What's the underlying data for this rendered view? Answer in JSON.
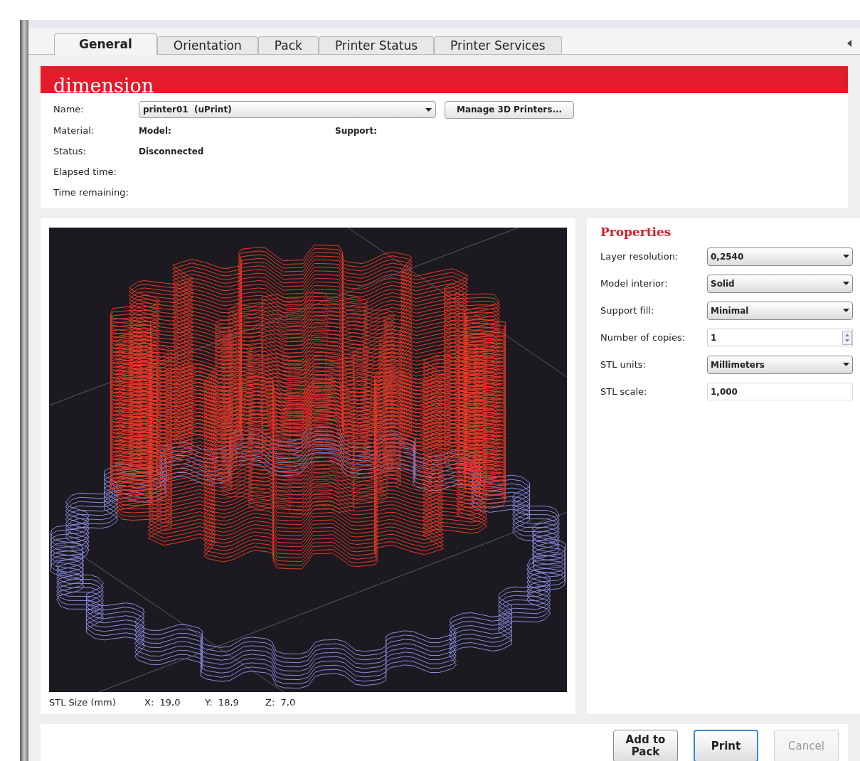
{
  "tabs": [
    {
      "label": "General",
      "selected": true
    },
    {
      "label": "Orientation",
      "selected": false
    },
    {
      "label": "Pack",
      "selected": false
    },
    {
      "label": "Printer Status",
      "selected": false
    },
    {
      "label": "Printer Services",
      "selected": false
    }
  ],
  "brand": {
    "logo": "dimension"
  },
  "printer": {
    "name_label": "Name:",
    "name_value": "printer01  (uPrint)",
    "manage_button": "Manage 3D Printers...",
    "material_label": "Material:",
    "model_label": "Model:",
    "support_label": "Support:",
    "status_label": "Status:",
    "status_value": "Disconnected",
    "elapsed_label": "Elapsed time:",
    "remaining_label": "Time remaining:"
  },
  "viewer": {
    "size_label": "STL Size (mm)",
    "x": "X:  19,0",
    "y": "Y:  18,9",
    "z": "Z:  7,0"
  },
  "properties": {
    "title": "Properties",
    "rows": [
      {
        "kind": "dropdown",
        "label": "Layer resolution:",
        "value": "0,2540"
      },
      {
        "kind": "dropdown",
        "label": "Model interior:",
        "value": "Solid"
      },
      {
        "kind": "dropdown",
        "label": "Support fill:",
        "value": "Minimal"
      },
      {
        "kind": "spinner",
        "label": "Number of copies:",
        "value": "1"
      },
      {
        "kind": "dropdown",
        "label": "STL units:",
        "value": "Millimeters"
      },
      {
        "kind": "text",
        "label": "STL scale:",
        "value": "1,000"
      }
    ]
  },
  "buttons": [
    {
      "label": "Add to\nPack",
      "disabled": false,
      "focused": false
    },
    {
      "label": "Print",
      "disabled": false,
      "focused": true
    },
    {
      "label": "Cancel",
      "disabled": true,
      "focused": false
    }
  ]
}
